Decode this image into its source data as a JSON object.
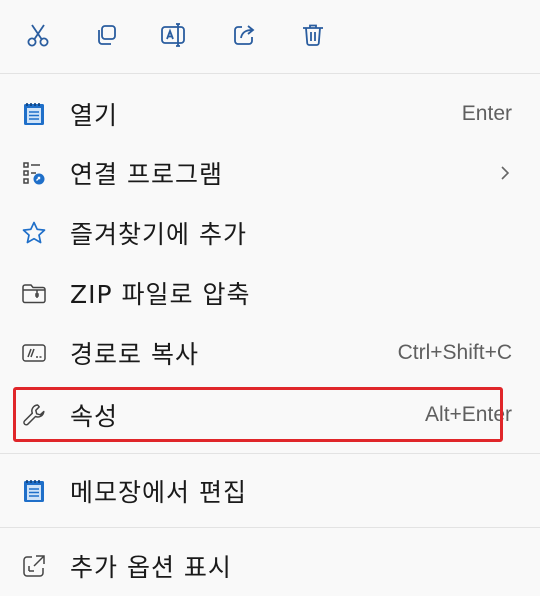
{
  "toolbar": {
    "buttons": [
      {
        "icon": "cut-icon"
      },
      {
        "icon": "copy-icon"
      },
      {
        "icon": "rename-icon"
      },
      {
        "icon": "share-icon"
      },
      {
        "icon": "delete-icon"
      }
    ]
  },
  "menu": {
    "items": [
      {
        "icon": "notepad-icon",
        "label": "열기",
        "shortcut": "Enter"
      },
      {
        "icon": "open-with-icon",
        "label": "연결 프로그램",
        "submenu": true
      },
      {
        "icon": "star-icon",
        "label": "즐겨찾기에 추가"
      },
      {
        "icon": "zip-folder-icon",
        "label": "ZIP 파일로 압축"
      },
      {
        "icon": "copy-path-icon",
        "label": "경로로 복사",
        "shortcut": "Ctrl+Shift+C"
      },
      {
        "icon": "wrench-icon",
        "label": "속성",
        "shortcut": "Alt+Enter",
        "highlighted": true
      },
      {
        "icon": "notepad-icon",
        "label": "메모장에서 편집"
      },
      {
        "icon": "more-options-icon",
        "label": "추가 옵션 표시"
      }
    ]
  },
  "colors": {
    "accent": "#1f6fc9",
    "highlight_border": "#e0262a",
    "background": "#f9f9f9"
  }
}
